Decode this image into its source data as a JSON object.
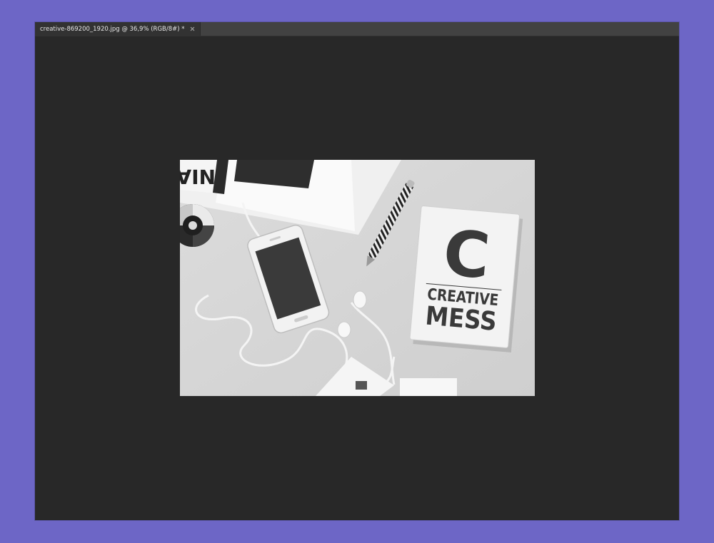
{
  "document_tab": {
    "title": "creative-869200_1920.jpg @ 36,9% (RGB/8#) *",
    "close_icon": "close-icon"
  },
  "photo": {
    "notebook_letter": "C",
    "notebook_line1": "CREATIVE",
    "notebook_line2": "MESS",
    "paper_fragment": "NIA"
  },
  "colors": {
    "accent_background": "#6d66c6",
    "workspace": "#282828",
    "tabbar": "#424242",
    "tab_active": "#323232"
  }
}
